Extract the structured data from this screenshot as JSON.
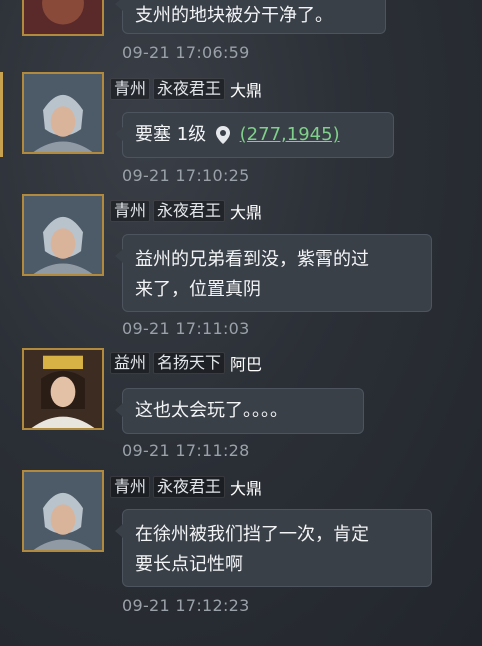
{
  "prev": {
    "text": "支州的地块被分干净了。",
    "timestamp": "09-21 17:06:59"
  },
  "messages": [
    {
      "region": "青州",
      "guild": "永夜君王",
      "name": "大鼎",
      "text_prefix": "要塞 1级",
      "coord": "(277,1945)",
      "timestamp": "09-21 17:10:25"
    },
    {
      "region": "青州",
      "guild": "永夜君王",
      "name": "大鼎",
      "line1": "益州的兄弟看到没，紫霄的过",
      "line2": "来了，位置真阴",
      "timestamp": "09-21 17:11:03"
    },
    {
      "region": "益州",
      "guild": "名扬天下",
      "name": "阿巴",
      "text": "这也太会玩了。。。。",
      "timestamp": "09-21 17:11:28"
    },
    {
      "region": "青州",
      "guild": "永夜君王",
      "name": "大鼎",
      "line1": "在徐州被我们挡了一次，肯定",
      "line2": "要长点记性啊",
      "timestamp": "09-21 17:12:23"
    }
  ],
  "icons": {
    "location": "map-pin-icon"
  },
  "colors": {
    "coord_link": "#7fd08a",
    "avatar_border": "#b18a3e",
    "bubble": "#3a4048"
  }
}
